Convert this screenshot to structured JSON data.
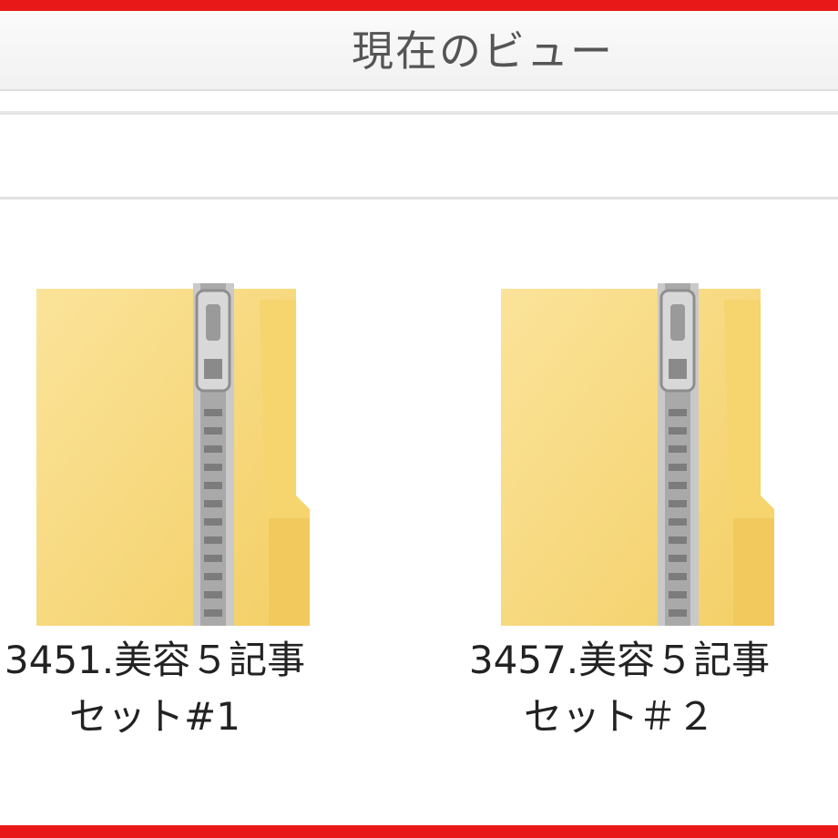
{
  "ribbon": {
    "group_label": "現在のビュー"
  },
  "files": [
    {
      "name_line1": "3451.美容５記事",
      "name_line2": "セット#1",
      "icon": "zip-folder-icon"
    },
    {
      "name_line1": "3457.美容５記事",
      "name_line2": "セット＃２",
      "icon": "zip-folder-icon"
    }
  ],
  "colors": {
    "frame": "#e81818",
    "folder": "#f8d775",
    "zipper": "#b8b8b8"
  }
}
